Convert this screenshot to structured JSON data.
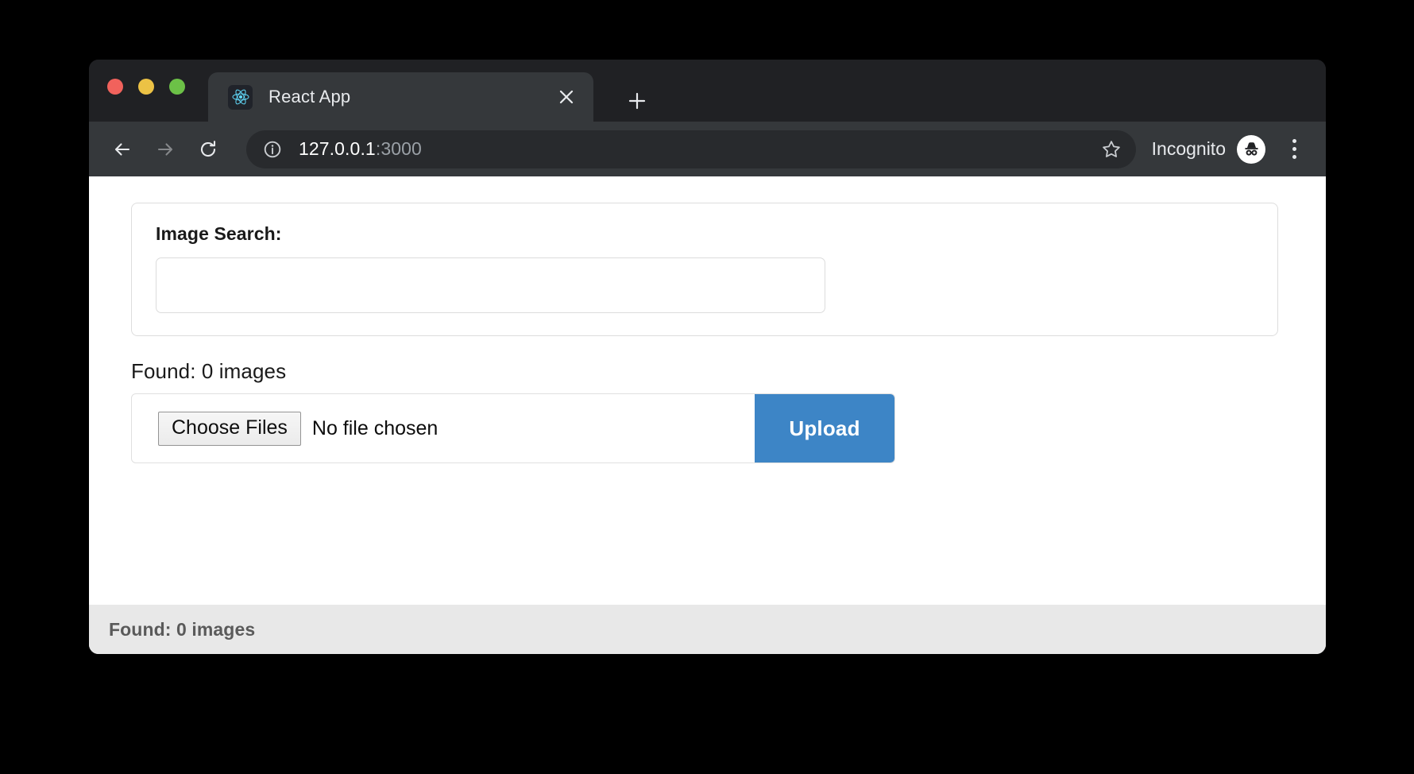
{
  "window": {
    "traffic_lights": [
      {
        "name": "close",
        "color": "#f1625c"
      },
      {
        "name": "minimize",
        "color": "#ecc245"
      },
      {
        "name": "zoom",
        "color": "#6cc147"
      }
    ]
  },
  "tab_strip": {
    "tabs": [
      {
        "title": "React App",
        "favicon": "react-logo-icon",
        "close_label": "×"
      }
    ],
    "new_tab_label": "+"
  },
  "toolbar": {
    "back_icon": "arrow-left-icon",
    "forward_icon": "arrow-right-icon",
    "reload_icon": "reload-icon",
    "site_info_icon": "info-circle-icon",
    "url_host": "127.0.0.1",
    "url_port": ":3000",
    "url_full": "127.0.0.1:3000",
    "bookmark_icon": "star-outline-icon",
    "profile_label": "Incognito",
    "profile_icon": "incognito-avatar-icon",
    "menu_icon": "three-dot-menu-icon"
  },
  "page": {
    "search_card": {
      "label": "Image Search:",
      "input_value": "",
      "input_placeholder": ""
    },
    "found_count_text": "Found: 0 images",
    "upload_row": {
      "choose_files_label": "Choose Files",
      "no_file_chosen_text": "No file chosen",
      "upload_label": "Upload"
    },
    "status_bar_text": "Found: 0 images"
  },
  "colors": {
    "tab_strip_bg": "#202124",
    "toolbar_bg": "#35383b",
    "omnibox_bg": "#282a2d",
    "upload_button": "#3d85c6",
    "status_bar_bg": "#e8e8e8",
    "react_blue": "#61dafb"
  }
}
